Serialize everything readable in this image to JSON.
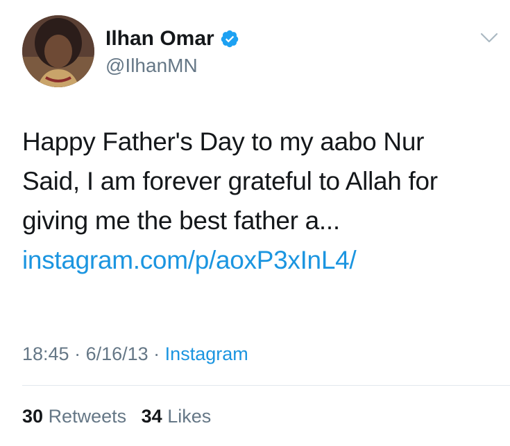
{
  "author": {
    "name": "Ilhan Omar",
    "handle": "@IlhanMN",
    "verified": true
  },
  "tweet": {
    "lines": [
      "Happy Father's Day to my aabo Nur",
      "Said, I am forever grateful to Allah for",
      "giving me the best father a..."
    ],
    "link": "instagram.com/p/aoxP3xInL4/"
  },
  "meta": {
    "time": "18:45",
    "sep1": " · ",
    "date": "6/16/13",
    "sep2": " · ",
    "source": "Instagram"
  },
  "stats": {
    "retweets_count": "30",
    "retweets_label": "Retweets",
    "likes_count": "34",
    "likes_label": "Likes"
  },
  "colors": {
    "link": "#1b95e0",
    "secondary_text": "#657786",
    "verified": "#1da1f2"
  },
  "icons": {
    "verified": "verified-badge-icon",
    "menu": "chevron-down-icon"
  }
}
